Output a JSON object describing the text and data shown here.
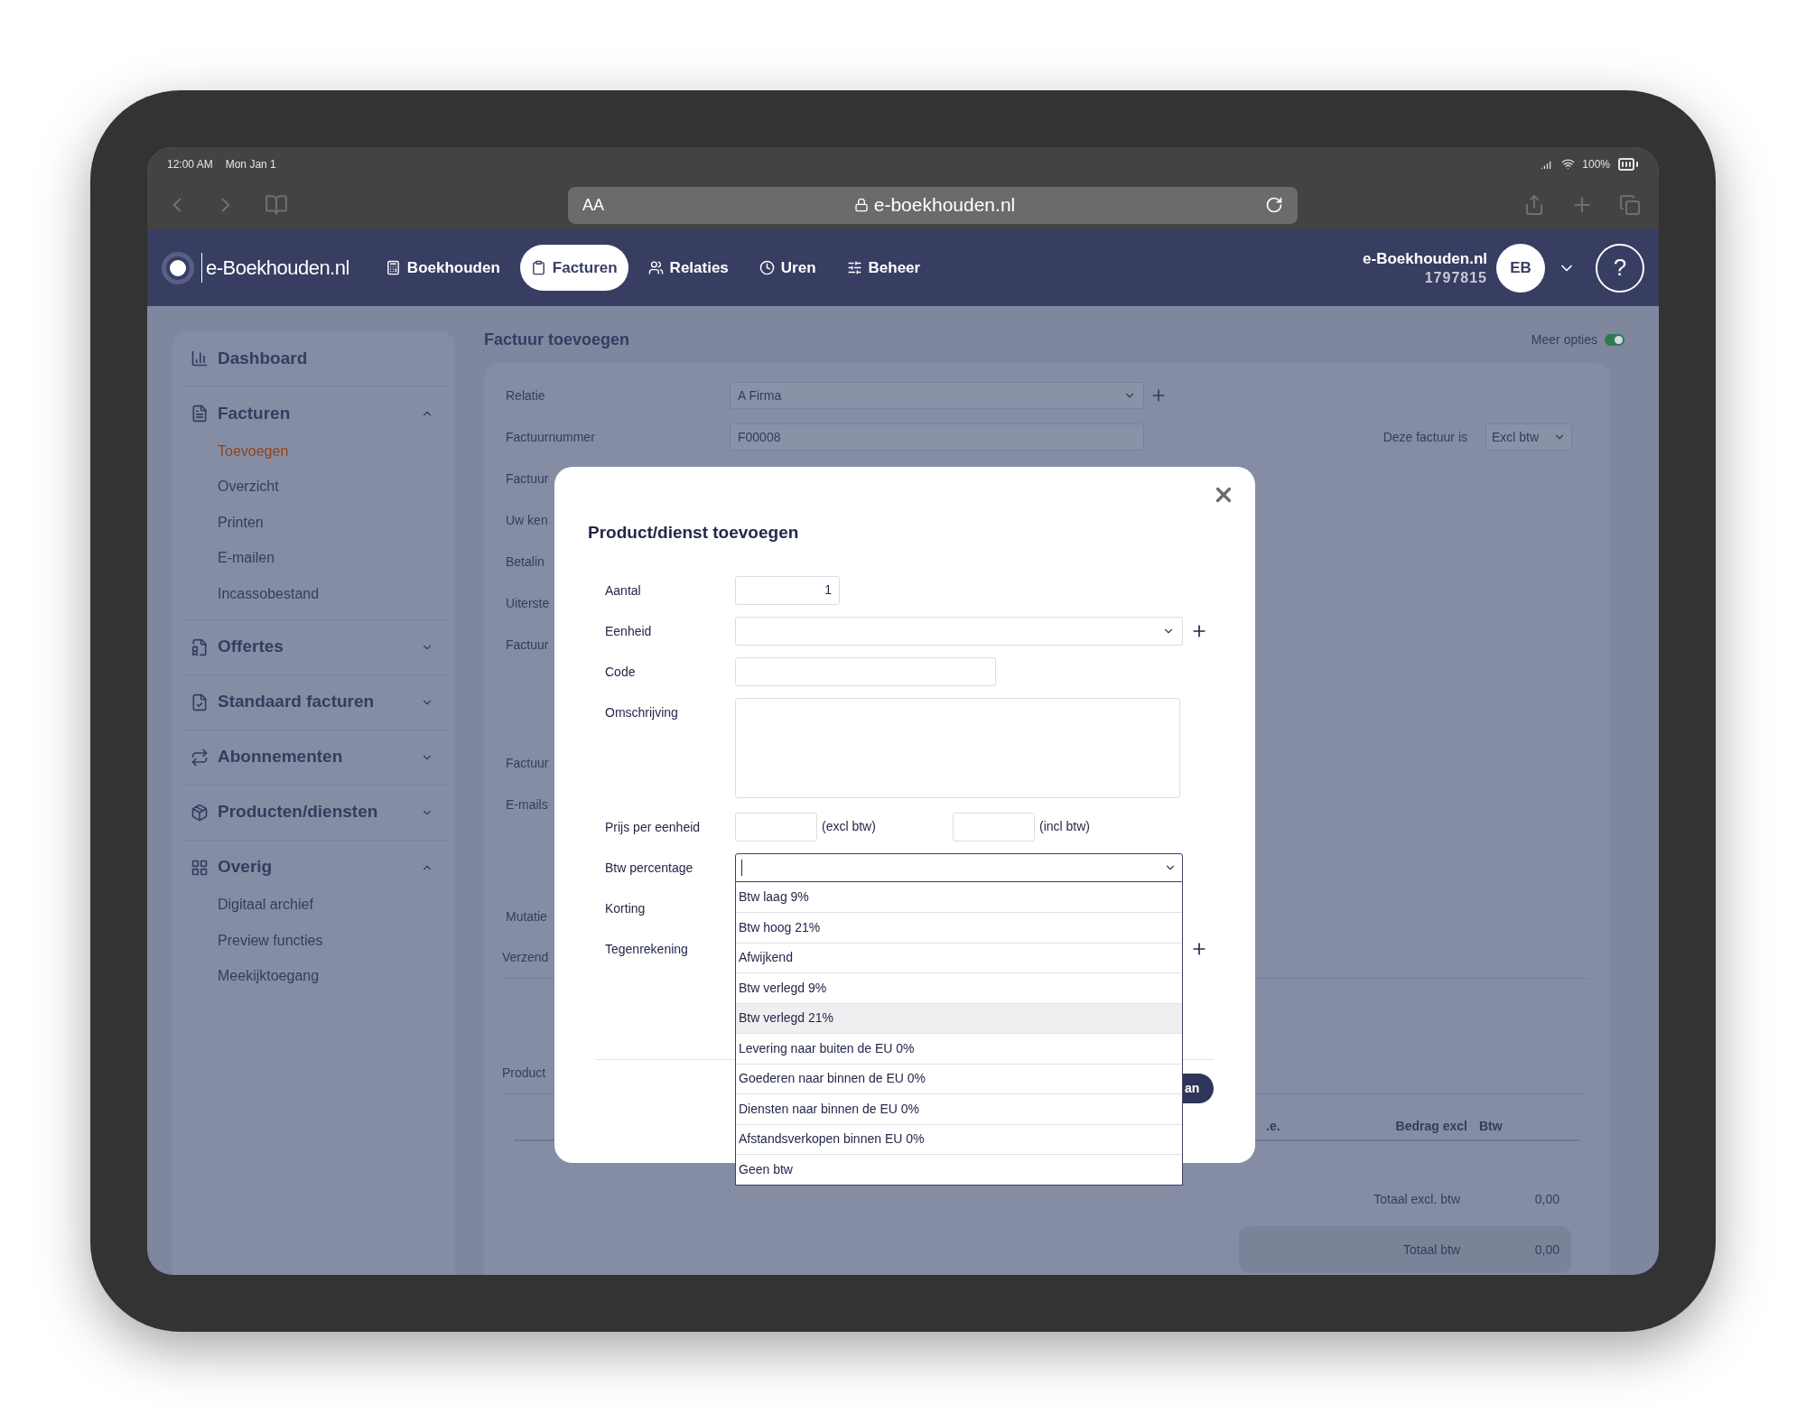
{
  "status_bar": {
    "time": "12:00 AM",
    "date": "Mon Jan 1",
    "battery": "100%"
  },
  "browser": {
    "text_size": "AA",
    "url": "e-boekhouden.nl"
  },
  "nav": {
    "logo": "e-Boekhouden.nl",
    "items": [
      {
        "label": "Boekhouden",
        "selected": false
      },
      {
        "label": "Facturen",
        "selected": true
      },
      {
        "label": "Relaties",
        "selected": false
      },
      {
        "label": "Uren",
        "selected": false
      },
      {
        "label": "Beheer",
        "selected": false
      }
    ],
    "account": {
      "name": "e-Boekhouden.nl",
      "number": "1797815",
      "initials": "EB"
    },
    "help": "?"
  },
  "sidebar": {
    "sections": [
      {
        "label": "Dashboard",
        "kind": "link"
      },
      {
        "label": "Facturen",
        "kind": "group",
        "expanded": true,
        "children": [
          {
            "label": "Toevoegen",
            "selected": true
          },
          {
            "label": "Overzicht",
            "selected": false
          },
          {
            "label": "Printen",
            "selected": false
          },
          {
            "label": "E-mailen",
            "selected": false
          },
          {
            "label": "Incassobestand",
            "selected": false
          }
        ]
      },
      {
        "label": "Offertes",
        "kind": "group",
        "expanded": false
      },
      {
        "label": "Standaard facturen",
        "kind": "group",
        "expanded": false
      },
      {
        "label": "Abonnementen",
        "kind": "group",
        "expanded": false
      },
      {
        "label": "Producten/diensten",
        "kind": "group",
        "expanded": false
      },
      {
        "label": "Overig",
        "kind": "group",
        "expanded": true,
        "children": [
          {
            "label": "Digitaal archief",
            "selected": false
          },
          {
            "label": "Preview functies",
            "selected": false
          },
          {
            "label": "Meekijktoegang",
            "selected": false
          }
        ]
      }
    ]
  },
  "page": {
    "title": "Factuur toevoegen",
    "more_options": {
      "label": "Meer opties",
      "on": true
    },
    "form_rows": [
      {
        "label": "Relatie",
        "kind": "select",
        "value": "A Firma",
        "add": true
      },
      {
        "label": "Factuurnummer",
        "kind": "text",
        "value": "F00008",
        "aside": {
          "label": "Deze factuur is",
          "value": "Excl btw"
        }
      },
      {
        "label": "Factuur",
        "kind": "none"
      },
      {
        "label": "Uw ken",
        "kind": "none"
      },
      {
        "label": "Betalin",
        "kind": "none"
      },
      {
        "label": "Uiterste",
        "kind": "none"
      },
      {
        "label": "Factuur",
        "kind": "none"
      },
      {
        "label": "Factuur",
        "kind": "none"
      },
      {
        "label": "E-mails",
        "kind": "none"
      },
      {
        "label": "Mutatie",
        "kind": "none"
      },
      {
        "label": "Verzend",
        "kind": "section"
      },
      {
        "label": "Product",
        "kind": "section"
      }
    ],
    "table": {
      "columns": [
        ".e.",
        "Bedrag excl",
        "Btw"
      ]
    },
    "totals": [
      {
        "label": "Totaal excl. btw",
        "value": "0,00",
        "highlighted": false
      },
      {
        "label": "Totaal btw",
        "value": "0,00",
        "highlighted": true
      }
    ]
  },
  "modal": {
    "title": "Product/dienst toevoegen",
    "fields": [
      {
        "label": "Aantal",
        "kind": "number",
        "value": "1"
      },
      {
        "label": "Eenheid",
        "kind": "select",
        "add": true
      },
      {
        "label": "Code",
        "kind": "text"
      },
      {
        "label": "Omschrijving",
        "kind": "textarea"
      },
      {
        "label": "Prijs per eenheid",
        "kind": "price",
        "excl_label": "(excl btw)",
        "incl_label": "(incl btw)"
      },
      {
        "label": "Btw percentage",
        "kind": "select_open",
        "options": [
          {
            "label": "Btw laag 9%",
            "highlighted": false
          },
          {
            "label": "Btw hoog 21%",
            "highlighted": false
          },
          {
            "label": "Afwijkend",
            "highlighted": false
          },
          {
            "label": "Btw verlegd 9%",
            "highlighted": false
          },
          {
            "label": "Btw verlegd 21%",
            "highlighted": true
          },
          {
            "label": "Levering naar buiten de EU 0%",
            "highlighted": false
          },
          {
            "label": "Goederen naar binnen de EU 0%",
            "highlighted": false
          },
          {
            "label": "Diensten naar binnen de EU 0%",
            "highlighted": false
          },
          {
            "label": "Afstandsverkopen binnen EU 0%",
            "highlighted": false
          },
          {
            "label": "Geen btw",
            "highlighted": false
          }
        ]
      },
      {
        "label": "Korting",
        "kind": "covered"
      },
      {
        "label": "Tegenrekening",
        "kind": "covered",
        "add": true
      }
    ],
    "footer_button": "an"
  }
}
